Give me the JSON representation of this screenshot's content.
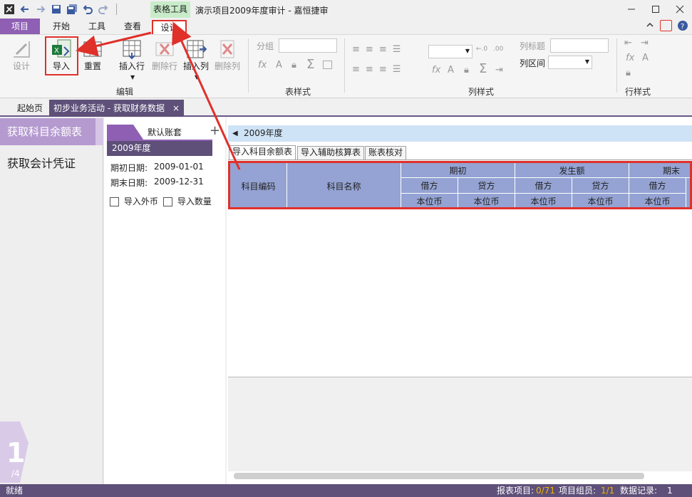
{
  "titlebar": {
    "context_tab": "表格工具",
    "app_title": "演示项目2009年度审计 - 嘉恒捷审",
    "quick_access": [
      "app-logo-icon",
      "back-icon",
      "forward-icon",
      "save-icon",
      "save-all-icon",
      "undo-icon",
      "redo-icon"
    ],
    "window_buttons": [
      "minimize-icon",
      "maximize-icon",
      "close-icon"
    ]
  },
  "menu": {
    "tabs": [
      "项目",
      "开始",
      "工具",
      "查看",
      "设计"
    ],
    "active": "设计"
  },
  "ribbon": {
    "groups": {
      "edit": "编辑",
      "table_style": "表样式",
      "column_style": "列样式",
      "row_style": "行样式"
    },
    "buttons": {
      "design": "设计",
      "import": "导入",
      "reset": "重置",
      "insert_row": "插入行",
      "delete_row": "删除行",
      "insert_col": "插入列",
      "delete_col": "删除列"
    },
    "table_style": {
      "group_label": "分组",
      "group_value": ""
    },
    "column_style": {
      "col_title_label": "列标题",
      "col_title_value": "",
      "col_range_label": "列区间",
      "col_range_value": ""
    }
  },
  "doc_tabs": {
    "start": "起始页",
    "active": "初步业务活动 - 获取财务数据",
    "close": "×"
  },
  "sidebar": {
    "items": [
      "获取科目余额表",
      "获取会计凭证"
    ],
    "pager_current": "1",
    "pager_total": "/4"
  },
  "account_set": {
    "tab": "默认账套",
    "add": "+",
    "year": "2009年度",
    "start_label": "期初日期:",
    "start_date": "2009-01-01",
    "end_label": "期末日期:",
    "end_date": "2009-12-31",
    "import_foreign": "导入外币",
    "import_quantity": "导入数量"
  },
  "main": {
    "year_bar": "2009年度",
    "subtabs": [
      "导入科目余额表",
      "导入辅助核算表",
      "账表核对"
    ],
    "grid_header": {
      "code": "科目编码",
      "name": "科目名称",
      "opening": "期初",
      "occurrence": "发生额",
      "closing": "期末",
      "debit": "借方",
      "credit": "贷方",
      "currency": "本位币"
    }
  },
  "status": {
    "ready": "就绪",
    "report_label": "报表项目:",
    "report_value": "0/71",
    "group_label": "项目组员:",
    "group_value": "1/1",
    "records_label": "数据记录:",
    "records_value": "1"
  },
  "colors": {
    "accent": "#8e5fb3",
    "dark": "#5e5079",
    "highlight": "#e0302a",
    "grid_header": "#94a3d3"
  }
}
